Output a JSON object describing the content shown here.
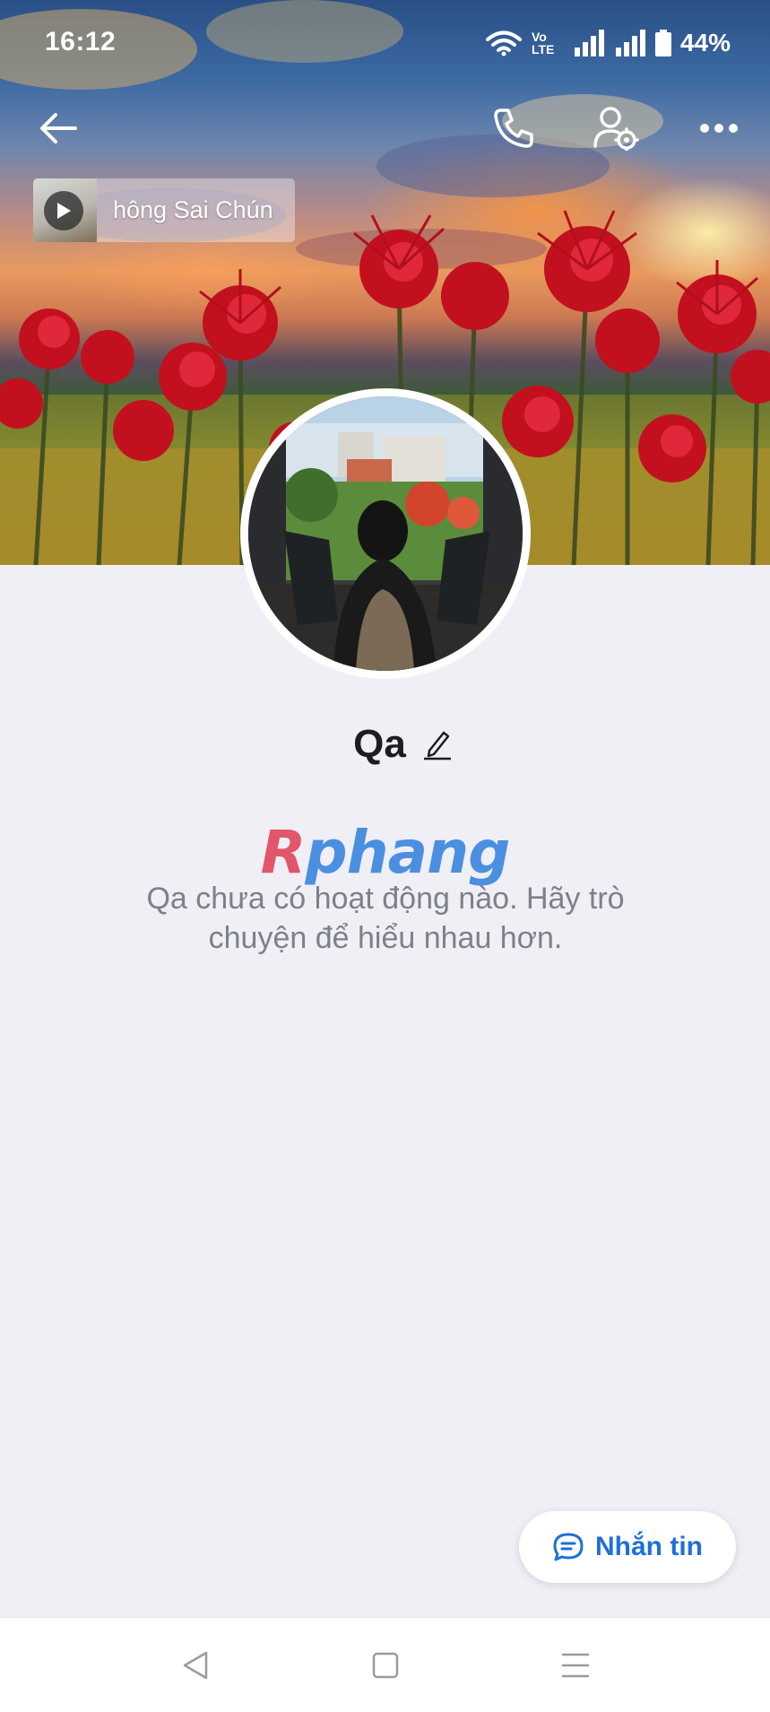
{
  "status_bar": {
    "time": "16:12",
    "network_label": "Vo LTE",
    "battery": "44%"
  },
  "top_bar": {
    "back_icon": "arrow-left-icon",
    "call_icon": "phone-icon",
    "settings_icon": "user-gear-icon",
    "more_icon": "more-horizontal-icon"
  },
  "music": {
    "title": "hông Sai Chún"
  },
  "profile": {
    "name": "Qa",
    "edit_icon": "pencil-icon"
  },
  "watermark": {
    "part1": "R",
    "part2": "phang"
  },
  "empty_state": {
    "message": "Qa chưa có hoạt động nào. Hãy trò chuyện để hiểu nhau hơn."
  },
  "message_button": {
    "label": "Nhắn tin",
    "icon": "chat-bubble-icon"
  },
  "nav_bar": {
    "back": "nav-back-icon",
    "home": "nav-home-icon",
    "menu": "nav-menu-icon"
  },
  "colors": {
    "accent": "#1e6fd9",
    "background": "#f0eff5",
    "muted_text": "#7c8189"
  }
}
